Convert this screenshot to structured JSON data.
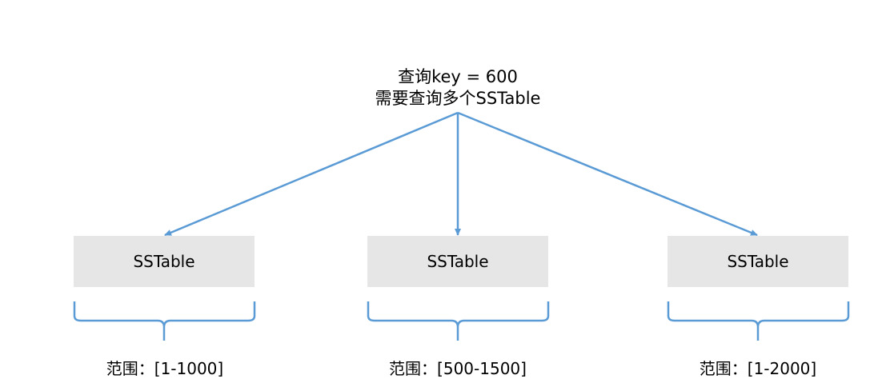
{
  "query": {
    "line1": "查询key = 600",
    "line2": "需要查询多个SSTable"
  },
  "sstables": [
    {
      "label": "SSTable",
      "range": "范围：[1-1000]"
    },
    {
      "label": "SSTable",
      "range": "范围：[500-1500]"
    },
    {
      "label": "SSTable",
      "range": "范围：[1-2000]"
    }
  ],
  "colors": {
    "arrow": "#5b9bd5",
    "box_fill": "#e6e6e6",
    "text": "#000000"
  }
}
